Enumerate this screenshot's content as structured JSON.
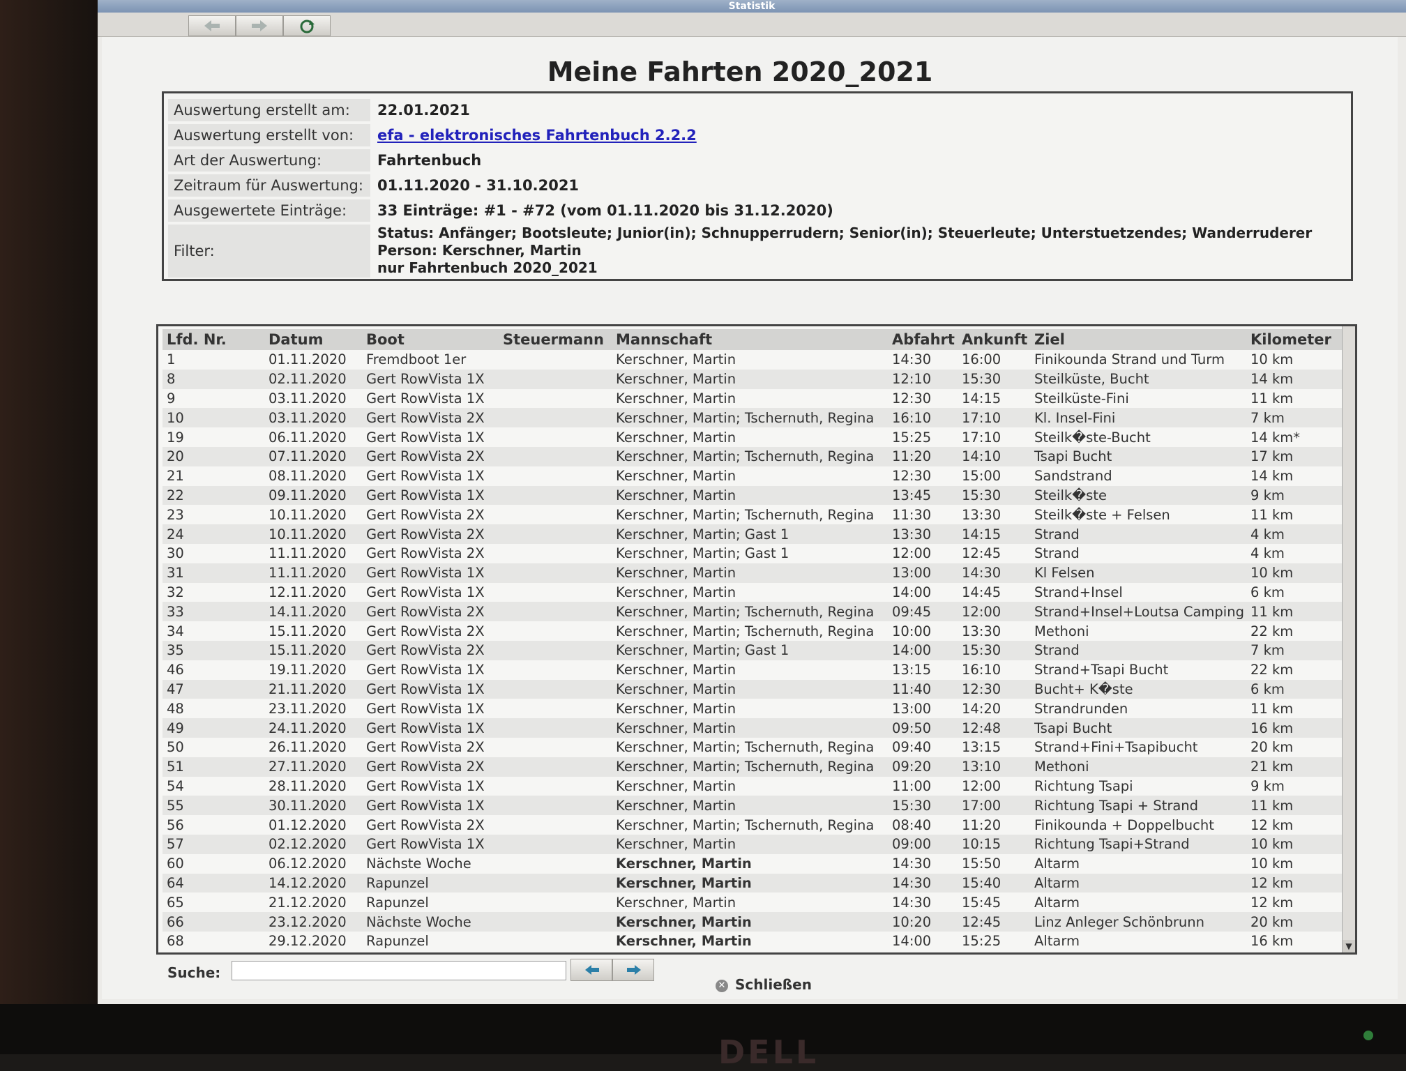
{
  "window": {
    "title": "Statistik"
  },
  "page": {
    "title": "Meine Fahrten 2020_2021"
  },
  "info": [
    {
      "label": "Auswertung erstellt am:",
      "value": "22.01.2021"
    },
    {
      "label": "Auswertung erstellt von:",
      "value": "efa - elektronisches Fahrtenbuch 2.2.2"
    },
    {
      "label": "Art der Auswertung:",
      "value": "Fahrtenbuch"
    },
    {
      "label": "Zeitraum für Auswertung:",
      "value": "01.11.2020 - 31.10.2021"
    },
    {
      "label": "Ausgewertete Einträge:",
      "value": "33 Einträge: #1 - #72 (vom 01.11.2020 bis 31.12.2020)"
    }
  ],
  "filter": {
    "label": "Filter:",
    "lines": [
      "Status: Anfänger; Bootsleute; Junior(in); Schnupperrudern; Senior(in); Steuerleute; Unterstuetzendes; Wanderruderer",
      "Person: Kerschner, Martin",
      "nur Fahrtenbuch 2020_2021"
    ]
  },
  "table": {
    "headers": [
      "Lfd. Nr.",
      "Datum",
      "Boot",
      "Steuermann",
      "Mannschaft",
      "Abfahrt",
      "Ankunft",
      "Ziel",
      "Kilometer"
    ],
    "rows": [
      [
        "1",
        "01.11.2020",
        "Fremdboot 1er",
        "",
        "Kerschner, Martin",
        "14:30",
        "16:00",
        "Finikounda Strand und Turm",
        "10 km"
      ],
      [
        "8",
        "02.11.2020",
        "Gert RowVista 1X",
        "",
        "Kerschner, Martin",
        "12:10",
        "15:30",
        "Steilküste, Bucht",
        "14 km"
      ],
      [
        "9",
        "03.11.2020",
        "Gert RowVista 1X",
        "",
        "Kerschner, Martin",
        "12:30",
        "14:15",
        "Steilküste-Fini",
        "11 km"
      ],
      [
        "10",
        "03.11.2020",
        "Gert RowVista 2X",
        "",
        "Kerschner, Martin; Tschernuth, Regina",
        "16:10",
        "17:10",
        "Kl. Insel-Fini",
        "7 km"
      ],
      [
        "19",
        "06.11.2020",
        "Gert RowVista 1X",
        "",
        "Kerschner, Martin",
        "15:25",
        "17:10",
        "Steilk�ste-Bucht",
        "14 km*"
      ],
      [
        "20",
        "07.11.2020",
        "Gert RowVista 2X",
        "",
        "Kerschner, Martin; Tschernuth, Regina",
        "11:20",
        "14:10",
        "Tsapi Bucht",
        "17 km"
      ],
      [
        "21",
        "08.11.2020",
        "Gert RowVista 1X",
        "",
        "Kerschner, Martin",
        "12:30",
        "15:00",
        "Sandstrand",
        "14 km"
      ],
      [
        "22",
        "09.11.2020",
        "Gert RowVista 1X",
        "",
        "Kerschner, Martin",
        "13:45",
        "15:30",
        "Steilk�ste",
        "9 km"
      ],
      [
        "23",
        "10.11.2020",
        "Gert RowVista 2X",
        "",
        "Kerschner, Martin; Tschernuth, Regina",
        "11:30",
        "13:30",
        "Steilk�ste + Felsen",
        "11 km"
      ],
      [
        "24",
        "10.11.2020",
        "Gert RowVista 2X",
        "",
        "Kerschner, Martin; Gast 1",
        "13:30",
        "14:15",
        "Strand",
        "4 km"
      ],
      [
        "30",
        "11.11.2020",
        "Gert RowVista 2X",
        "",
        "Kerschner, Martin; Gast 1",
        "12:00",
        "12:45",
        "Strand",
        "4 km"
      ],
      [
        "31",
        "11.11.2020",
        "Gert RowVista 1X",
        "",
        "Kerschner, Martin",
        "13:00",
        "14:30",
        "Kl Felsen",
        "10 km"
      ],
      [
        "32",
        "12.11.2020",
        "Gert RowVista 1X",
        "",
        "Kerschner, Martin",
        "14:00",
        "14:45",
        "Strand+Insel",
        "6 km"
      ],
      [
        "33",
        "14.11.2020",
        "Gert RowVista 2X",
        "",
        "Kerschner, Martin; Tschernuth, Regina",
        "09:45",
        "12:00",
        "Strand+Insel+Loutsa Camping",
        "11 km"
      ],
      [
        "34",
        "15.11.2020",
        "Gert RowVista 2X",
        "",
        "Kerschner, Martin; Tschernuth, Regina",
        "10:00",
        "13:30",
        "Methoni",
        "22 km"
      ],
      [
        "35",
        "15.11.2020",
        "Gert RowVista 2X",
        "",
        "Kerschner, Martin; Gast 1",
        "14:00",
        "15:30",
        "Strand",
        "7 km"
      ],
      [
        "46",
        "19.11.2020",
        "Gert RowVista 1X",
        "",
        "Kerschner, Martin",
        "13:15",
        "16:10",
        "Strand+Tsapi Bucht",
        "22 km"
      ],
      [
        "47",
        "21.11.2020",
        "Gert RowVista 1X",
        "",
        "Kerschner, Martin",
        "11:40",
        "12:30",
        "Bucht+ K�ste",
        "6 km"
      ],
      [
        "48",
        "23.11.2020",
        "Gert RowVista 1X",
        "",
        "Kerschner, Martin",
        "13:00",
        "14:20",
        "Strandrunden",
        "11 km"
      ],
      [
        "49",
        "24.11.2020",
        "Gert RowVista 1X",
        "",
        "Kerschner, Martin",
        "09:50",
        "12:48",
        "Tsapi Bucht",
        "16 km"
      ],
      [
        "50",
        "26.11.2020",
        "Gert RowVista 2X",
        "",
        "Kerschner, Martin; Tschernuth, Regina",
        "09:40",
        "13:15",
        "Strand+Fini+Tsapibucht",
        "20 km"
      ],
      [
        "51",
        "27.11.2020",
        "Gert RowVista 2X",
        "",
        "Kerschner, Martin; Tschernuth, Regina",
        "09:20",
        "13:10",
        "Methoni",
        "21 km"
      ],
      [
        "54",
        "28.11.2020",
        "Gert RowVista 1X",
        "",
        "Kerschner, Martin",
        "11:00",
        "12:00",
        "Richtung Tsapi",
        "9 km"
      ],
      [
        "55",
        "30.11.2020",
        "Gert RowVista 1X",
        "",
        "Kerschner, Martin",
        "15:30",
        "17:00",
        "Richtung Tsapi + Strand",
        "11 km"
      ],
      [
        "56",
        "01.12.2020",
        "Gert RowVista 2X",
        "",
        "Kerschner, Martin; Tschernuth, Regina",
        "08:40",
        "11:20",
        "Finikounda + Doppelbucht",
        "12 km"
      ],
      [
        "57",
        "02.12.2020",
        "Gert RowVista 1X",
        "",
        "Kerschner, Martin",
        "09:00",
        "10:15",
        "Richtung Tsapi+Strand",
        "10 km"
      ],
      [
        "60",
        "06.12.2020",
        "Nächste Woche",
        "",
        "Kerschner, Martin",
        "14:30",
        "15:50",
        "Altarm",
        "10 km"
      ],
      [
        "64",
        "14.12.2020",
        "Rapunzel",
        "",
        "Kerschner, Martin",
        "14:30",
        "15:40",
        "Altarm",
        "12 km"
      ],
      [
        "65",
        "21.12.2020",
        "Rapunzel",
        "",
        "Kerschner, Martin",
        "14:30",
        "15:45",
        "Altarm",
        "12 km"
      ],
      [
        "66",
        "23.12.2020",
        "Nächste Woche",
        "",
        "Kerschner, Martin",
        "10:20",
        "12:45",
        "Linz Anleger Schönbrunn",
        "20 km"
      ],
      [
        "68",
        "29.12.2020",
        "Rapunzel",
        "",
        "Kerschner, Martin",
        "14:00",
        "15:25",
        "Altarm",
        "16 km"
      ]
    ],
    "bold_crew_rows": [
      26,
      27,
      29,
      30
    ]
  },
  "search": {
    "label": "Suche:",
    "value": ""
  },
  "close_button": {
    "label": "Schließen"
  },
  "monitor": {
    "brand": "DELL"
  }
}
